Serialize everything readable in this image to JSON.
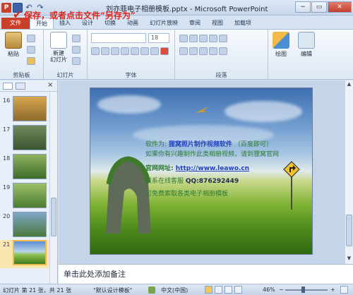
{
  "window": {
    "title": "刘亦菲电子相册模板.pptx - Microsoft PowerPoint",
    "app_icon": "P",
    "controls": {
      "minimize": "−",
      "maximize": "▭",
      "close": "✕"
    }
  },
  "annotation": {
    "check": "✔",
    "text": "保存，或者点击文件“另存为”"
  },
  "tabs": [
    {
      "label": "文件"
    },
    {
      "label": "开始"
    },
    {
      "label": "插入"
    },
    {
      "label": "设计"
    },
    {
      "label": "切换"
    },
    {
      "label": "动画"
    },
    {
      "label": "幻灯片放映"
    },
    {
      "label": "审阅"
    },
    {
      "label": "视图"
    },
    {
      "label": "加载项"
    }
  ],
  "ribbon": {
    "clipboard": {
      "paste_label": "粘贴",
      "group_label": "剪贴板"
    },
    "slides": {
      "new_slide_label": "新建\n幻灯片",
      "group_label": "幻灯片"
    },
    "font": {
      "size_value": "18",
      "group_label": "字体"
    },
    "paragraph": {
      "group_label": "段落"
    },
    "drawing": {
      "label": "绘图"
    },
    "editing": {
      "label": "编辑"
    }
  },
  "thumbnails": [
    {
      "number": "16"
    },
    {
      "number": "17"
    },
    {
      "number": "18"
    },
    {
      "number": "19"
    },
    {
      "number": "20"
    },
    {
      "number": "21"
    }
  ],
  "slide": {
    "line1_prefix": "软件为:",
    "line1_link": "狸窝照片制作视频软件",
    "line1_suffix": "（百度即可）",
    "line2": "如果你有兴趣制作此类相册视频，请到狸窝官网",
    "line3_label": "官网网址:",
    "line3_url": "http://www.leawo.cn",
    "line4_prefix": "联系在线客服",
    "line4_qq": "QQ:876292449",
    "line5": "可免费索取各类电子相册模板"
  },
  "notes": {
    "placeholder": "单击此处添加备注"
  },
  "status": {
    "slide_info": "幻灯片 第 21 张，共 21 张",
    "theme": "\"默认设计模板\"",
    "language": "中文(中国)",
    "zoom": "46%",
    "zoom_minus": "−",
    "zoom_plus": "+"
  }
}
